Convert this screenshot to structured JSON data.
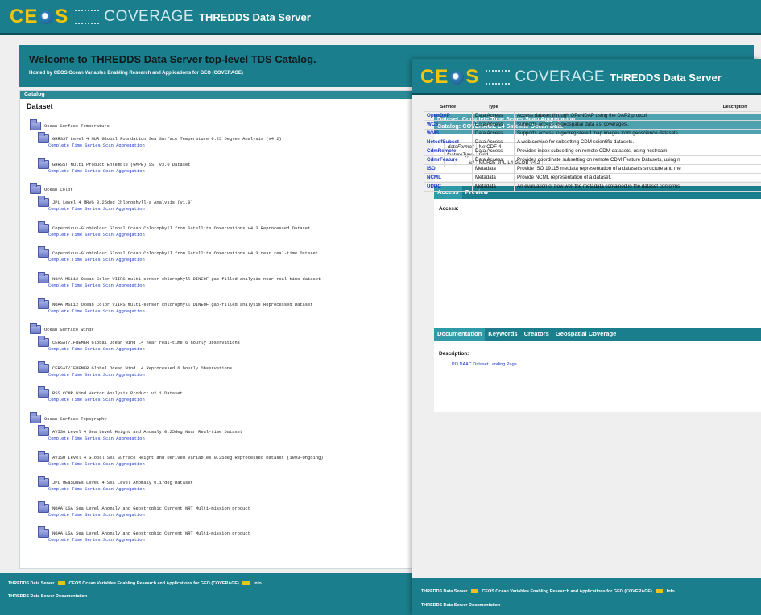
{
  "logo": {
    "ceos": "CE S",
    "coverage": "COVERAGE",
    "server": "THREDDS Data Server"
  },
  "catalog_window": {
    "welcome": "Welcome to THREDDS Data Server top-level TDS Catalog.",
    "hosted_by_prefix": "Hosted by",
    "hosted_by_link": "CEOS Ocean Variables Enabling Research and Applications for GEO (COVERAGE)",
    "catalog_label": "Catalog",
    "dataset_label": "Dataset",
    "groups": [
      {
        "name": "Ocean Surface Temperature",
        "datasets": [
          {
            "name": "GHRSST Level 4 MUR Global Foundation Sea Surface Temperature 0.25 Degree Analysis (v4.2)",
            "link": "Complete Time Series Scan Aggregation"
          },
          {
            "name": "GHRSST Multi Product Ensemble (GMPE) SST v3.0 Dataset",
            "link": "Complete Time Series Scan Aggregation"
          }
        ]
      },
      {
        "name": "Ocean Color",
        "datasets": [
          {
            "name": "JPL Level 4 MRVG 0.25deg Chlorophyll-a Analysis (v1.0)",
            "link": "Complete Time Series Scan Aggregation"
          },
          {
            "name": "Copernicus-GlobColour Global Ocean Chlorophyll from Satellite Observations v4.3 Reprocessed Dataset",
            "link": "Complete Time Series Scan Aggregation"
          },
          {
            "name": "Copernicus-GlobColour Global Ocean Chlorophyll from Satellite Observations v4.3 near real-time Dataset",
            "link": "Complete Time Series Scan Aggregation"
          },
          {
            "name": "NOAA MSL12 Ocean Color VIIRS multi-sensor chlorophyll DINEOF gap-filled analysis near real-time dataset",
            "link": "Complete Time Series Scan Aggregation"
          },
          {
            "name": "NOAA MSL12 Ocean Color VIIRS multi-sensor chlorophyll DINEOF gap-filled analysis Reprocessed Dataset",
            "link": "Complete Time Series Scan Aggregation"
          }
        ]
      },
      {
        "name": "Ocean Surface Winds",
        "datasets": [
          {
            "name": "CERSAT/IFREMER Global Ocean Wind L4 near real-time 6 hourly Observations",
            "link": "Complete Time Series Scan Aggregation"
          },
          {
            "name": "CERSAT/IFREMER Global Ocean Wind L4 Reprocessed 6 hourly Observations",
            "link": "Complete Time Series Scan Aggregation"
          },
          {
            "name": "RSS CCMP Wind Vector Analysis Product v2.1 Dataset",
            "link": "Complete Time Series Scan Aggregation"
          }
        ]
      },
      {
        "name": "Ocean Surface Topography",
        "datasets": [
          {
            "name": "AVISO Level 4 Sea Level Height and Anomaly 0.25deg Near Real-time Dataset",
            "link": "Complete Time Series Scan Aggregation"
          },
          {
            "name": "AVISO Level 4 Global Sea Surface Height and Derived Variables 0.25deg Reprocessed Dataset (1993-Ongoing)",
            "link": "Complete Time Series Scan Aggregation"
          },
          {
            "name": "JPL MEaSUREs Level 4 Sea Level Anomaly 0.17deg Dataset",
            "link": "Complete Time Series Scan Aggregation"
          },
          {
            "name": "NOAA LSA Sea Level Anomaly and Geostrophic Current NRT Multi-mission product",
            "link": "Complete Time Series Scan Aggregation"
          },
          {
            "name": "NOAA LSA Sea Level Anomaly and Geostrophic Current NRT Multi-mission product",
            "link": "Complete Time Series Scan Aggregation"
          }
        ]
      }
    ],
    "footer": {
      "server": "THREDDS Data Server",
      "at": "at",
      "org": "CEOS Ocean Variables Enabling Research and Applications for GEO (COVERAGE)",
      "see": "see",
      "info": "Info",
      "docs": "THREDDS Data Server Documentation"
    }
  },
  "dataset_window": {
    "dataset_title": "Dataset: Complete Time Series Scan Aggregation",
    "catalog_title": "Catalog: COVERAGE L4 Satellite Ocean Data",
    "info": [
      {
        "key": "dataFormat",
        "value": "NetCDF-4"
      },
      {
        "key": "featureType",
        "value": "Grid"
      },
      {
        "key": "id",
        "value": "MUR25-JPL-L4-GLOB-v4.2"
      }
    ],
    "tabs": [
      "Access",
      "Preview"
    ],
    "access_label": "Access:",
    "columns": [
      "Service",
      "Type",
      "Description"
    ],
    "services": [
      {
        "service": "OpenDAP",
        "type": "Data Access",
        "desc": "Access dataset through OPeNDAP using the DAP2 protcol."
      },
      {
        "service": "WCS",
        "type": "Data Access",
        "desc": "Supports access to geospatial data as 'coverages'."
      },
      {
        "service": "WMS",
        "type": "Data Access",
        "desc": "Supports access to georegistered map images from geoscience datasets."
      },
      {
        "service": "NetcdfSubset",
        "type": "Data Access",
        "desc": "A web service for subsetting CDM scientific datasets."
      },
      {
        "service": "CdmRemote",
        "type": "Data Access",
        "desc": "Provides index subsetting on remote CDM datasets, using ncstream."
      },
      {
        "service": "CdmrFeature",
        "type": "Data Access",
        "desc": "Provides coordinate subsetting on remote CDM Feature Datasets, using n"
      },
      {
        "service": "ISO",
        "type": "Metadata",
        "desc": "Provide ISO 19115 metdata representation of a dataset's structure and me"
      },
      {
        "service": "NCML",
        "type": "Metadata",
        "desc": "Provide NCML representation of a dataset."
      },
      {
        "service": "UDDC",
        "type": "Metadata",
        "desc": "An evaluation of how well the metadata contained in the dataset conforms"
      }
    ],
    "doc_tabs": [
      "Documentation",
      "Keywords",
      "Creators",
      "Geospatial Coverage"
    ],
    "description_label": "Description:",
    "description_links": [
      "PO.DAAC Dataset Landing Page"
    ],
    "footer": {
      "server": "THREDDS Data Server",
      "at": "at",
      "org": "CEOS Ocean Variables Enabling Research and Applications for GEO (COVERAGE)",
      "see": "see",
      "info": "Info",
      "docs": "THREDDS Data Server Documentation"
    }
  }
}
